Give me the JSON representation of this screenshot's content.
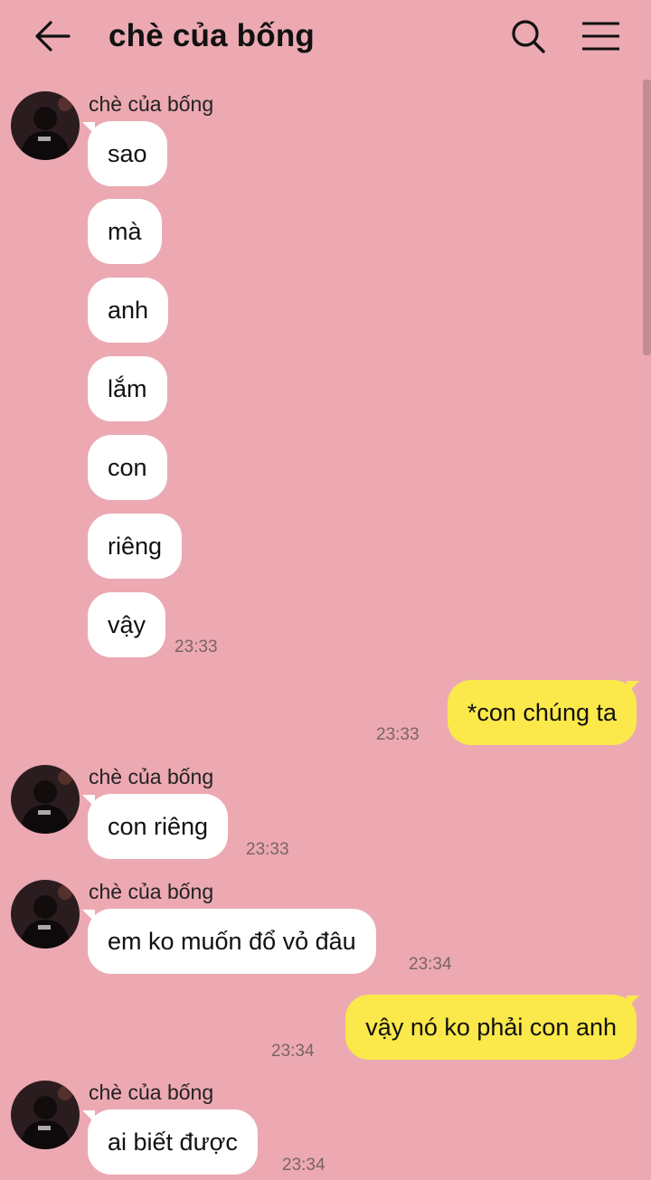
{
  "header": {
    "title": "chè của bống",
    "back_icon": "arrow-left-icon",
    "search_icon": "search-icon",
    "menu_icon": "hamburger-menu-icon"
  },
  "colors": {
    "background": "#eca9b2",
    "incoming_bubble": "#ffffff",
    "outgoing_bubble": "#fbe84a"
  },
  "messages": [
    {
      "sender": "chè của bống",
      "lines": [
        "sao",
        "mà",
        "anh",
        "lắm",
        "con",
        "riêng",
        "vậy"
      ],
      "time": "23:33"
    },
    {
      "direction": "out",
      "text": "*con chúng ta",
      "time": "23:33"
    },
    {
      "sender": "chè của bống",
      "text": "con riêng",
      "time": "23:33"
    },
    {
      "sender": "chè của bống",
      "text": "em ko muốn đổ vỏ đâu",
      "time": "23:34"
    },
    {
      "direction": "out",
      "text": "vậy nó ko phải con anh",
      "time": "23:34"
    },
    {
      "sender": "chè của bống",
      "text": "ai biết được",
      "time": "23:34"
    }
  ]
}
